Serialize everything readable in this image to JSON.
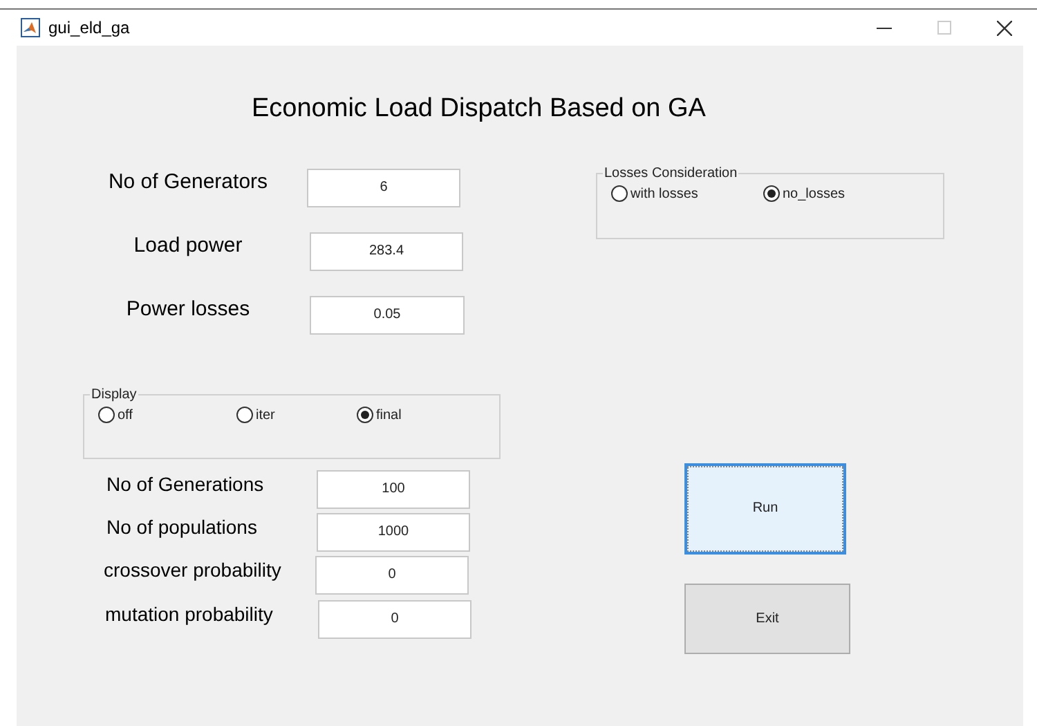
{
  "window": {
    "title": "gui_eld_ga"
  },
  "heading": "Economic Load Dispatch Based on GA",
  "parameters": [
    {
      "label": "No of Generators",
      "value": "6"
    },
    {
      "label": "Load power",
      "value": "283.4"
    },
    {
      "label": "Power losses",
      "value": "0.05"
    }
  ],
  "losses_consideration": {
    "title": "Losses Consideration",
    "options": [
      {
        "label": "with losses",
        "selected": false
      },
      {
        "label": "no_losses",
        "selected": true
      }
    ]
  },
  "display": {
    "title": "Display",
    "options": [
      {
        "label": "off",
        "selected": false
      },
      {
        "label": "iter",
        "selected": false
      },
      {
        "label": "final",
        "selected": true
      }
    ]
  },
  "ga_settings": [
    {
      "label": "No of Generations",
      "value": "100"
    },
    {
      "label": "No of populations",
      "value": "1000"
    },
    {
      "label": "crossover probability",
      "value": "0"
    },
    {
      "label": "mutation probability",
      "value": "0"
    }
  ],
  "buttons": [
    {
      "label": "Run",
      "focused": true
    },
    {
      "label": "Exit",
      "focused": false
    }
  ]
}
